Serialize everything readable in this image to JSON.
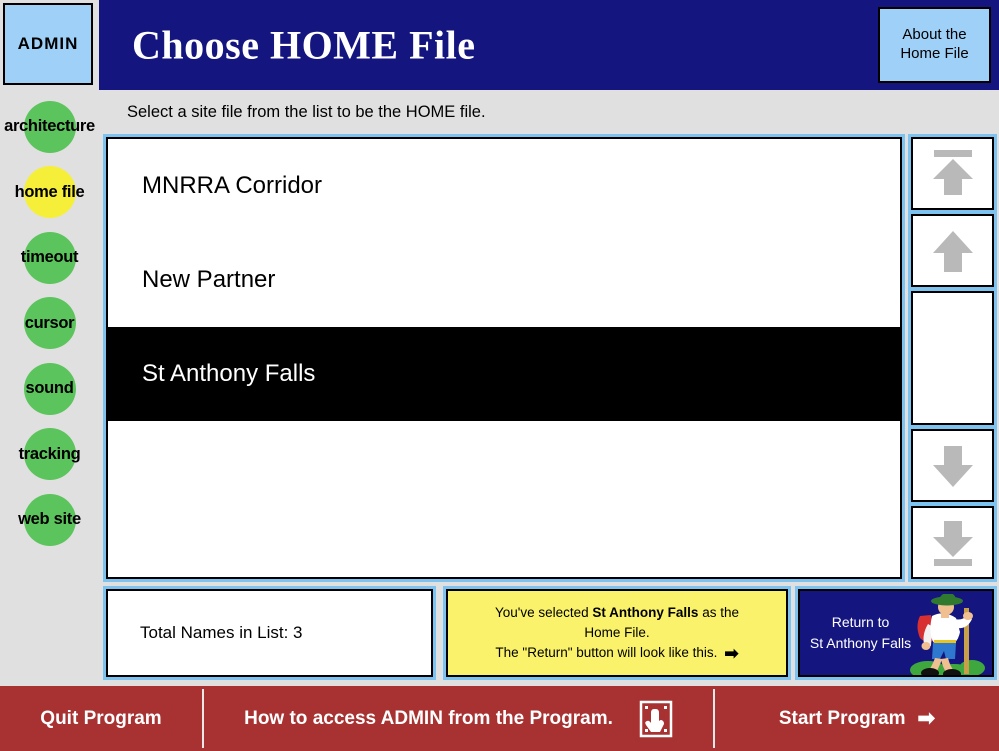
{
  "sidebar": {
    "admin_tab_label": "ADMIN",
    "items": [
      {
        "label": "architecture",
        "active": false
      },
      {
        "label": "home file",
        "active": true
      },
      {
        "label": "timeout",
        "active": false
      },
      {
        "label": "cursor",
        "active": false
      },
      {
        "label": "sound",
        "active": false
      },
      {
        "label": "tracking",
        "active": false
      },
      {
        "label": "web site",
        "active": false
      }
    ]
  },
  "header": {
    "title": "Choose HOME File",
    "about_button": {
      "line1": "About the",
      "line2": "Home File"
    }
  },
  "subtitle": {
    "text": "Select a site file from the list to be the HOME file."
  },
  "list": {
    "rows": [
      {
        "label": "MNRRA Corridor",
        "selected": false
      },
      {
        "label": "New Partner",
        "selected": false
      },
      {
        "label": "St Anthony Falls",
        "selected": true
      },
      {
        "label": "",
        "selected": false
      }
    ]
  },
  "scrollbar": {
    "buttons": [
      {
        "name": "scroll-to-top-button",
        "icon": "arrow-up-to-bar-icon"
      },
      {
        "name": "scroll-up-button",
        "icon": "arrow-up-icon"
      },
      {
        "name": "scroll-track",
        "icon": "none"
      },
      {
        "name": "scroll-down-button",
        "icon": "arrow-down-icon"
      },
      {
        "name": "scroll-to-bottom-button",
        "icon": "arrow-down-to-bar-icon"
      }
    ]
  },
  "footer": {
    "total_label": "Total Names in List:  3",
    "notice": {
      "line1_prefix": "You've selected ",
      "line1_selection": "St Anthony Falls",
      "line1_suffix": " as the",
      "line2": "Home File.",
      "line3": "The \"Return\" button will look like this.",
      "arrow_glyph": "➡"
    },
    "return_button": {
      "line1": "Return to",
      "line2": "St Anthony Falls",
      "icon": "hiker-icon"
    }
  },
  "toolbar": {
    "quit_label": "Quit Program",
    "admin_help_label": "How to access ADMIN from the Program.",
    "touch_icon": "touchscreen-hand-icon",
    "start_label": "Start Program",
    "start_arrow_glyph": "➡"
  },
  "colors": {
    "header_navy": "#151580",
    "sidebar_gray": "#e0e0e0",
    "tab_light_blue": "#9fd0f7",
    "panel_border_blue": "#7ec3ef",
    "dot_green": "#5cc45c",
    "dot_yellow": "#f6ef3a",
    "notice_yellow": "#f9f26a",
    "toolbar_red": "#a83232",
    "arrow_gray": "#b9b9b9"
  }
}
